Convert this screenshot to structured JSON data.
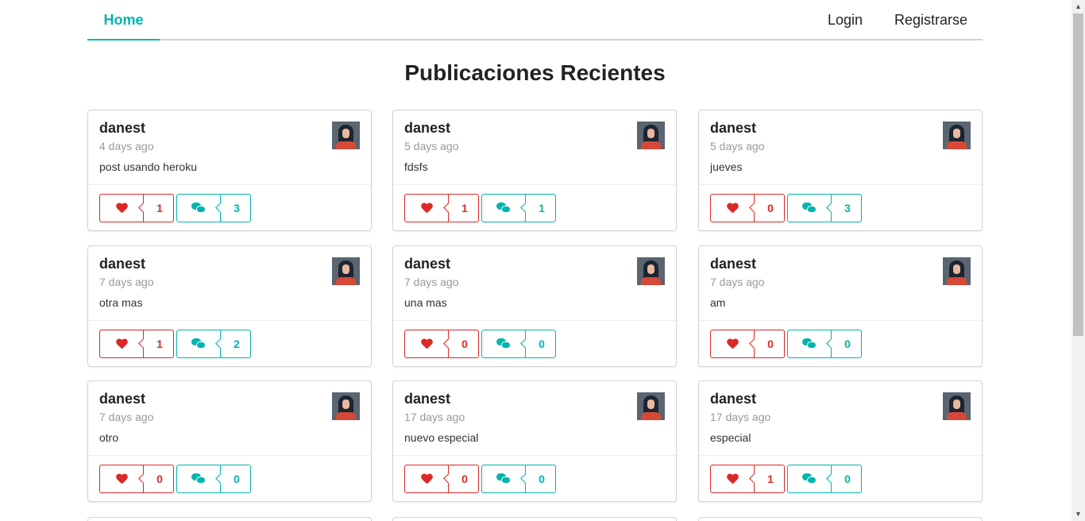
{
  "nav": {
    "home": "Home",
    "login": "Login",
    "register": "Registrarse"
  },
  "page": {
    "title": "Publicaciones Recientes"
  },
  "posts": [
    {
      "user": "danest",
      "date": "4 days ago",
      "text": "post usando heroku",
      "likes": "1",
      "comments": "3"
    },
    {
      "user": "danest",
      "date": "5 days ago",
      "text": "fdsfs",
      "likes": "1",
      "comments": "1"
    },
    {
      "user": "danest",
      "date": "5 days ago",
      "text": "jueves",
      "likes": "0",
      "comments": "3"
    },
    {
      "user": "danest",
      "date": "7 days ago",
      "text": "otra mas",
      "likes": "1",
      "comments": "2"
    },
    {
      "user": "danest",
      "date": "7 days ago",
      "text": "una mas",
      "likes": "0",
      "comments": "0"
    },
    {
      "user": "danest",
      "date": "7 days ago",
      "text": "am",
      "likes": "0",
      "comments": "0"
    },
    {
      "user": "danest",
      "date": "7 days ago",
      "text": "otro",
      "likes": "0",
      "comments": "0"
    },
    {
      "user": "danest",
      "date": "17 days ago",
      "text": "nuevo especial",
      "likes": "0",
      "comments": "0"
    },
    {
      "user": "danest",
      "date": "17 days ago",
      "text": "especial",
      "likes": "1",
      "comments": "0"
    }
  ],
  "colors": {
    "accent": "#00b5ad",
    "like": "#db2828",
    "border": "#d4d4d5"
  },
  "icons": {
    "like": "heart-icon",
    "comment": "comments-icon",
    "avatar": "user-avatar"
  }
}
